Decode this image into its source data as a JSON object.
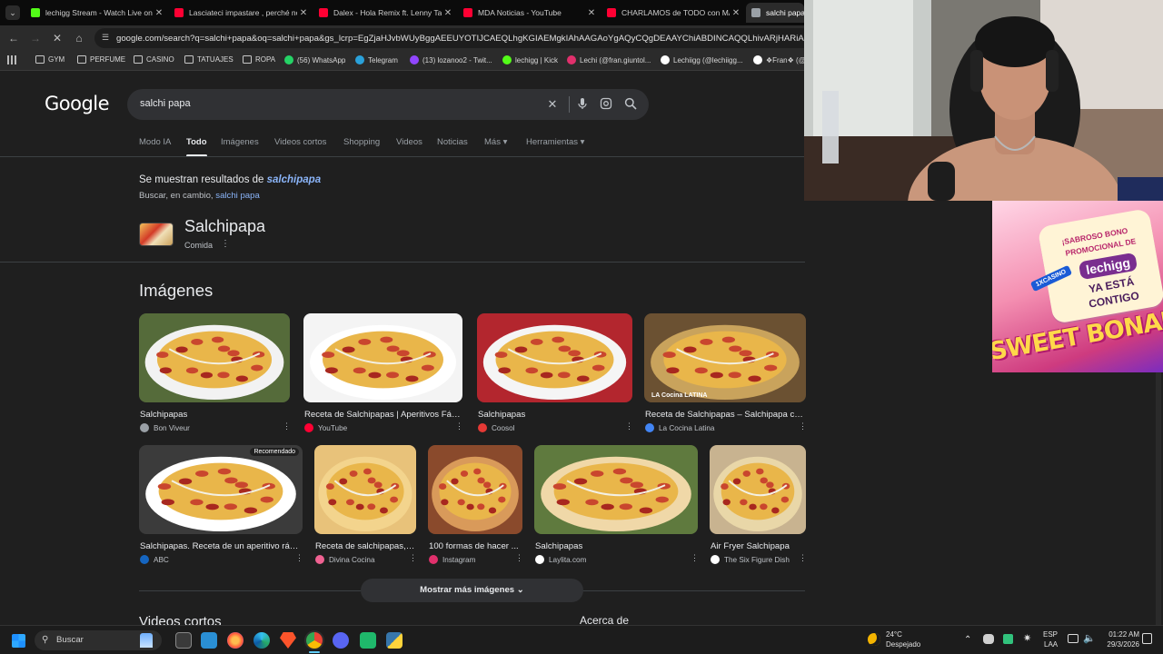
{
  "browser": {
    "tabs": [
      {
        "title": "lechigg Stream - Watch Live on",
        "favicon_color": "#53fc18",
        "favicon": "kick-icon"
      },
      {
        "title": "Lasciateci impastare , perché no",
        "favicon_color": "#ff0033",
        "favicon": "youtube-icon"
      },
      {
        "title": "Dalex - Hola Remix ft. Lenny Ta",
        "favicon_color": "#ff0033",
        "favicon": "youtube-icon"
      },
      {
        "title": "MDA Noticias - YouTube",
        "favicon_color": "#ff0033",
        "favicon": "youtube-icon"
      },
      {
        "title": "CHARLAMOS de TODO con MA",
        "favicon_color": "#ff0033",
        "favicon": "youtube-icon"
      },
      {
        "title": "salchi papa -",
        "favicon_color": "#9aa0a6",
        "favicon": "google-icon"
      }
    ],
    "url": "google.com/search?q=salchi+papa&oq=salchi+papa&gs_lcrp=EgZjaHJvbWUyBggAEEUYOTIJCAEQLhgKGIAEMgkIAhAAGAoYgAQyCQgDEAAYChiABDINCAQQLhivARjHARiABDIJCA",
    "bookmarks": [
      {
        "label": "GYM",
        "type": "folder"
      },
      {
        "label": "PERFUME",
        "type": "folder"
      },
      {
        "label": "CASINO",
        "type": "folder"
      },
      {
        "label": "TATUAJES",
        "type": "folder"
      },
      {
        "label": "ROPA",
        "type": "folder"
      },
      {
        "label": "(56) WhatsApp",
        "type": "site",
        "color": "#25d366"
      },
      {
        "label": "Telegram",
        "type": "site",
        "color": "#2aa1da"
      },
      {
        "label": "(13) lozanoo2 - Twit...",
        "type": "site",
        "color": "#9146ff"
      },
      {
        "label": "lechigg | Kick",
        "type": "site",
        "color": "#53fc18"
      },
      {
        "label": "Lechi (@fran.giuntol...",
        "type": "site",
        "color": "#e1306c"
      },
      {
        "label": "Lechiigg (@lechiigg...",
        "type": "site",
        "color": "#ffffff"
      },
      {
        "label": "❖Fran❖ (@f",
        "type": "site",
        "color": "#ffffff"
      }
    ]
  },
  "google": {
    "logo": "Google",
    "query": "salchi papa",
    "filters": [
      "Modo IA",
      "Todo",
      "Imágenes",
      "Videos cortos",
      "Shopping",
      "Videos",
      "Noticias",
      "Más ▾",
      "Herramientas ▾"
    ],
    "active_filter": "Todo",
    "spell_line_prefix": "Se muestran resultados de ",
    "spell_corrected": "salchipapa",
    "spell_alt_prefix": "Buscar, en cambio, ",
    "spell_alt_link": "salchi papa",
    "entity_title": "Salchipapa",
    "entity_subtitle": "Comida",
    "images_heading": "Imágenes",
    "images": [
      {
        "caption": "Salchipapas",
        "source": "Bon Viveur",
        "source_color": "#9aa0a6",
        "bg": "#556b3a",
        "plate": "#f2f2f2"
      },
      {
        "caption": "Receta de Salchipapas | Aperitivos Fácil...",
        "source": "YouTube",
        "source_color": "#ff0033",
        "bg": "#f4f4f4",
        "plate": "#ffffff"
      },
      {
        "caption": "Salchipapas",
        "source": "Coosol",
        "source_color": "#e53935",
        "bg": "#b3262e",
        "plate": "#f5f5f5"
      },
      {
        "caption": "Receta de Salchipapas – Salchipapa col...",
        "source": "La Cocina Latina",
        "source_color": "#4285f4",
        "bg": "#6b5132",
        "plate": "#c9a35c",
        "watermark": "LA Cocina LATINA"
      },
      {
        "caption": "Salchipapas. Receta de un aperitivo rápi...",
        "source": "ABC",
        "source_color": "#1565c0",
        "bg": "#3b3b3b",
        "plate": "#ffffff"
      },
      {
        "caption": "Receta de salchipapas, ...",
        "source": "Divina Cocina",
        "source_color": "#f06292",
        "bg": "#e8c27a",
        "plate": "#f3d48d"
      },
      {
        "caption": "100 formas de hacer ...",
        "source": "Instagram",
        "source_color": "#e1306c",
        "bg": "#8a4a2c",
        "plate": "#d99a5a"
      },
      {
        "caption": "Salchipapas",
        "source": "Laylita.com",
        "source_color": "#ffffff",
        "bg": "#5f7a3e",
        "plate": "#f0d8a8"
      },
      {
        "caption": "Air Fryer Salchipapa",
        "source": "The Six Figure Dish",
        "source_color": "#ffffff",
        "bg": "#c8b390",
        "plate": "#e9d7a8"
      }
    ],
    "more_images": "Mostrar más imágenes",
    "recommended_badge": "Recomendado",
    "videos_heading": "Videos cortos",
    "about_heading": "Acerca de"
  },
  "taskbar": {
    "search_placeholder": "Buscar",
    "weather_temp": "24°C",
    "weather_desc": "Despejado",
    "lang_line1": "ESP",
    "lang_line2": "LAA",
    "time": "01:22 AM",
    "date": "29/3/2026"
  },
  "overlay": {
    "promo_line1": "¡SABROSO BONO",
    "promo_line2": "PROMOCIONAL DE",
    "promo_brand": "lechigg",
    "promo_line3": "YA ESTÁ",
    "promo_line4": "CONTIGO",
    "promo_game": "SWEET BONANZA",
    "promo_casino": "1XCASINO"
  }
}
